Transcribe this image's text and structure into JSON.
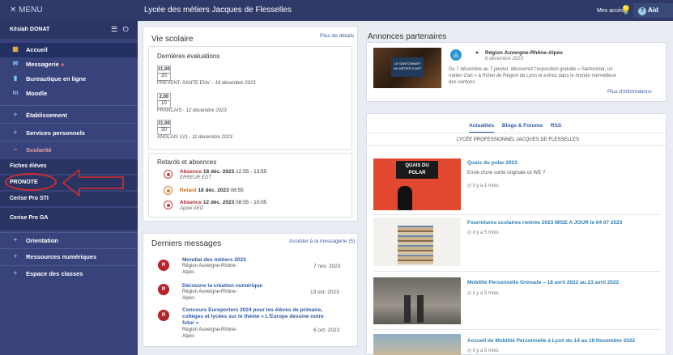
{
  "topbar": {
    "menu": "✕ MENU",
    "title": "Lycée des métiers Jacques de Flesselles",
    "mes_acces": "Mes accès ▾",
    "aide": "Aid"
  },
  "sidebar": {
    "user": "Késiah DONAT",
    "items": [
      {
        "label": "Accueil",
        "icon": "home-icon"
      },
      {
        "label": "Messagerie",
        "icon": "mail-icon"
      },
      {
        "label": "Bureautique en ligne",
        "icon": "office-icon"
      },
      {
        "label": "Moodle",
        "icon": "moodle-icon"
      }
    ],
    "sections": [
      "Établissement",
      "Services personnels",
      "Scolarité"
    ],
    "sub_items": [
      "Fiches élèves",
      "PRONOTE",
      "Cerise Pro STI",
      "Cerise Pro GA"
    ],
    "sections2": [
      "Orientation",
      "Ressources numériques",
      "Espace des classes"
    ]
  },
  "vie": {
    "title": "Vie scolaire",
    "details": "Plus de détails",
    "eval_title": "Dernières évaluations",
    "evals": [
      {
        "num": "11,00",
        "den": "20",
        "subject": "PREVENT. SANTE ENV.",
        "date": "18 décembre 2023"
      },
      {
        "num": "2,00",
        "den": "10",
        "subject": "FRANCAIS",
        "date": "12 décembre 2023"
      },
      {
        "num": "11,00",
        "den": "20",
        "subject": "ANGLAIS LV1",
        "date": "11 décembre 2023"
      }
    ],
    "retards_title": "Retards et absences",
    "retards": [
      {
        "kind": "Absence",
        "date": "18 déc. 2023",
        "time": "12:55 - 13:55",
        "note": "ERREUR EDT"
      },
      {
        "kind": "Retard",
        "date": "18 déc. 2023",
        "time": "08:55",
        "note": ""
      },
      {
        "kind": "Absence",
        "date": "12 déc. 2023",
        "time": "08:55 - 10:05",
        "note": "Appel AED"
      }
    ]
  },
  "messages": {
    "title": "Derniers messages",
    "link": "Accéder à la messagerie (5)",
    "items": [
      {
        "avatar": "R",
        "title": "Mondial des métiers 2023",
        "from1": "Région Auvergne-Rhône-",
        "from2": "Alpes",
        "date": "7 nov. 2023"
      },
      {
        "avatar": "R",
        "title": "Découvre la création numérique",
        "from1": "Région Auvergne-Rhône-",
        "from2": "Alpes",
        "date": "13 oct. 2023"
      },
      {
        "avatar": "R",
        "title1": "Concours Europorters 2024 pour les élèves de primaire,",
        "title2": "collèges et lycées sur le thème « L'Europe dessine notre",
        "title3": "futur »",
        "from1": "Région Auvergne-Rhône-",
        "from2": "Alpes",
        "date": "6 oct. 2023"
      }
    ]
  },
  "annonces": {
    "title": "Annonces partenaires",
    "org": "Région Auvergne-Rhône-Alpes",
    "date": "6 décembre 2023",
    "text1": "Du 7 décembre au 7 janvier, découvrez l'exposition gratuite « Santonnier, un",
    "text2": "métier d'art » à l'hôtel de Région de Lyon et entrez dans le monde merveilleux",
    "text3": "des santons",
    "more": "Plus d'informations",
    "thumb_text1": "LE SANTONNIER",
    "thumb_text2": "UN MÉTIER D'ART"
  },
  "news": {
    "tabs": [
      "Actualités",
      "Blogs & Forums",
      "RSS"
    ],
    "source": "LYCÉE PROFESSIONNEL JACQUES DE FLESSELLES",
    "items": [
      {
        "title": "Quais du polar 2023",
        "desc": "Envie d'une sortie originale ce WE ?",
        "ago": "il y a 1 mois",
        "thumb1": "QUAIS DU",
        "thumb2": "POLAR"
      },
      {
        "title": "Fournitures scolaires rentrée 2023 MISE A JOUR le 04 07 2023",
        "ago": "il y a 5 mois"
      },
      {
        "title": "Mobilité Personnelle Grenade – 18 avril 2022 au 23 avril 2022",
        "ago": "il y a 5 mois"
      },
      {
        "title": "Accueil de Mobilité Personnelle à Lyon du 14 au 18 Novembre 2022",
        "ago": "il y a 5 mois"
      }
    ]
  }
}
